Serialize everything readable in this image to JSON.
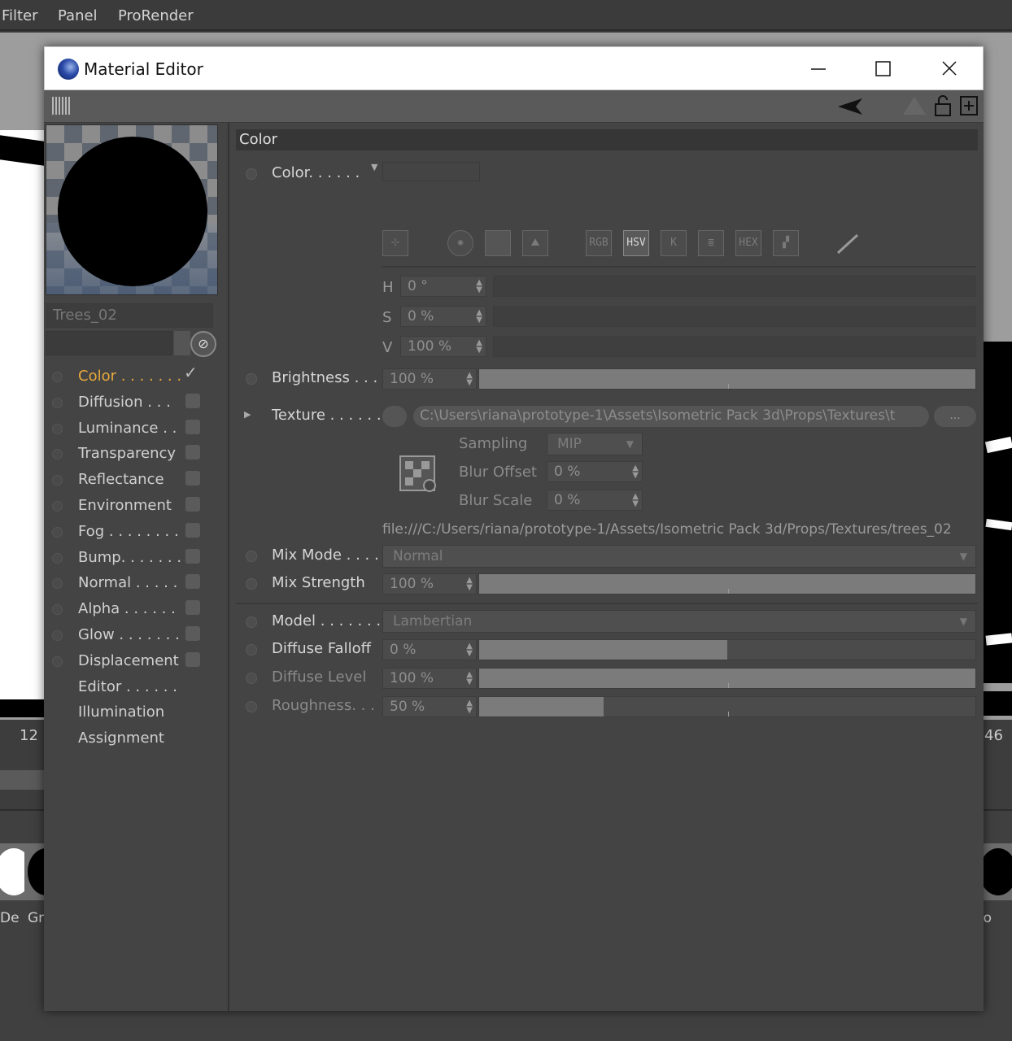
{
  "bg": {
    "menu": [
      "Filter",
      "Panel",
      "ProRender"
    ],
    "timeline": {
      "left_num": "12",
      "right_num": "46"
    },
    "thumbs": [
      "De",
      "Gr",
      "ro"
    ]
  },
  "window": {
    "title": "Material Editor",
    "icons": {
      "app": "cinema4d-icon",
      "minimize": "minimize-icon",
      "maximize": "maximize-icon",
      "close": "close-icon"
    }
  },
  "material": {
    "name": "Trees_02",
    "channels": [
      {
        "label": "Color . . . . . . .",
        "checked": true,
        "active": true
      },
      {
        "label": "Diffusion . . .",
        "checked": false
      },
      {
        "label": "Luminance . .",
        "checked": false
      },
      {
        "label": "Transparency",
        "checked": false
      },
      {
        "label": "Reflectance",
        "checked": false
      },
      {
        "label": "Environment",
        "checked": false
      },
      {
        "label": "Fog . . . . . . . .",
        "checked": false
      },
      {
        "label": "Bump. . . . . . .",
        "checked": false
      },
      {
        "label": "Normal . . . . .",
        "checked": false
      },
      {
        "label": "Alpha . . . . . .",
        "checked": false
      },
      {
        "label": "Glow . . . . . . .",
        "checked": false
      },
      {
        "label": "Displacement",
        "checked": false
      },
      {
        "label": "Editor . . . . . .",
        "checked": null
      },
      {
        "label": "Illumination",
        "checked": null
      },
      {
        "label": "Assignment",
        "checked": null
      }
    ]
  },
  "color_section": {
    "header": "Color",
    "color_label": "Color. . . . . .",
    "modes": [
      "RGB",
      "HSV",
      "K",
      "HEX"
    ],
    "h": {
      "label": "H",
      "value": "0 °"
    },
    "s": {
      "label": "S",
      "value": "0 %"
    },
    "v": {
      "label": "V",
      "value": "100 %"
    },
    "brightness": {
      "label": "Brightness . . .",
      "value": "100 %",
      "percent": 100
    },
    "texture": {
      "label": "Texture . . . . . .",
      "path": "C:\\Users\\riana\\prototype-1\\Assets\\Isometric Pack 3d\\Props\\Textures\\t",
      "browse": "...",
      "sampling_label": "Sampling",
      "sampling_value": "MIP",
      "blur_offset_label": "Blur Offset",
      "blur_offset_value": "0 %",
      "blur_scale_label": "Blur Scale",
      "blur_scale_value": "0 %",
      "file_url": "file:///C:/Users/riana/prototype-1/Assets/Isometric Pack 3d/Props/Textures/trees_02"
    },
    "mix_mode": {
      "label": "Mix Mode . . . .",
      "value": "Normal"
    },
    "mix_strength": {
      "label": "Mix Strength",
      "value": "100 %",
      "percent": 100
    },
    "model": {
      "label": "Model . . . . . . .",
      "value": "Lambertian"
    },
    "diffuse_falloff": {
      "label": "Diffuse Falloff",
      "value": "0 %",
      "percent": 50
    },
    "diffuse_level": {
      "label": "Diffuse Level",
      "value": "100 %",
      "percent": 100
    },
    "roughness": {
      "label": "Roughness. . .",
      "value": "50 %",
      "percent": 25
    }
  }
}
